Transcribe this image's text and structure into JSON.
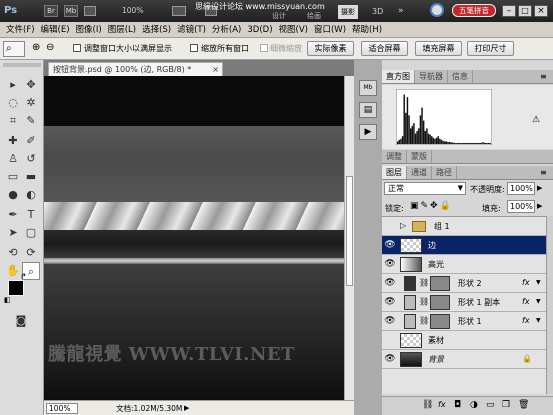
{
  "titlebar": {
    "app_logo": "Ps",
    "mini_buttons": [
      "Br",
      "Mb"
    ],
    "zoom": "100%",
    "workspace_buttons": [
      "设计",
      "绘画",
      "摄影",
      "3D"
    ],
    "more": "»",
    "watermark": "思缘设计论坛 www.missyuan.com",
    "ime_badge": "五笔拼音"
  },
  "menubar": {
    "items": [
      "文件(F)",
      "编辑(E)",
      "图像(I)",
      "图层(L)",
      "选择(S)",
      "滤镜(T)",
      "分析(A)",
      "3D(D)",
      "视图(V)",
      "窗口(W)",
      "帮助(H)"
    ]
  },
  "options": {
    "resize_windows": "调整窗口大小以满屏显示",
    "zoom_all": "缩放所有窗口",
    "scrubby_zoom": "细微缩放",
    "actual_pixels": "实际像素",
    "fit_screen": "适合屏幕",
    "fill_screen": "填充屏幕",
    "print_size": "打印尺寸"
  },
  "document": {
    "tab_title": "按钮背景.psd @ 100% (边, RGB/8) *",
    "close": "×",
    "watermark": "騰龍視覺 WWW.TLVI.NET",
    "zoom": "100%",
    "doc_size": "文档:1.02M/5.30M"
  },
  "histogram": {
    "tabs": [
      "直方图",
      "导航器",
      "信息"
    ],
    "bars": [
      0.05,
      0.08,
      0.1,
      0.15,
      0.95,
      0.6,
      0.9,
      0.55,
      0.3,
      0.35,
      0.4,
      0.2,
      0.25,
      0.3,
      0.55,
      0.7,
      0.45,
      0.25,
      0.3,
      0.2,
      0.18,
      0.15,
      0.12,
      0.1,
      0.12,
      0.15,
      0.1,
      0.08,
      0.06,
      0.05,
      0.05,
      0.04,
      0.04,
      0.03,
      0.03,
      0.02,
      0.02,
      0.02,
      0.02,
      0.02,
      0.02,
      0.02,
      0.02,
      0.02,
      0.02,
      0.02,
      0.02,
      0.02,
      0.02,
      0.02,
      0.02,
      0.02,
      0.03,
      0.03,
      0.02,
      0.02,
      0.02,
      0.02
    ]
  },
  "adjust_tabs": [
    "调整",
    "蒙版"
  ],
  "layers_panel": {
    "tabs": [
      "图层",
      "通道",
      "路径"
    ],
    "blend_mode": "正常",
    "opacity_label": "不透明度:",
    "opacity": "100%",
    "lock_label": "锁定:",
    "fill_label": "填充:",
    "fill": "100%",
    "group_name": "组 1",
    "layers": [
      {
        "name": "边",
        "selected": true,
        "visible": true,
        "fx": false
      },
      {
        "name": "高光",
        "selected": false,
        "visible": true,
        "fx": false
      },
      {
        "name": "形状 2",
        "selected": false,
        "visible": true,
        "fx": true
      },
      {
        "name": "形状 1 副本",
        "selected": false,
        "visible": true,
        "fx": true
      },
      {
        "name": "形状 1",
        "selected": false,
        "visible": true,
        "fx": true
      },
      {
        "name": "素材",
        "selected": false,
        "visible": false,
        "fx": false
      },
      {
        "name": "背景",
        "selected": false,
        "visible": true,
        "fx": false
      }
    ],
    "fx_symbol": "fx"
  },
  "colors": {
    "selection": "#0a246a",
    "titlebar": "#2a2a2a",
    "ime_red": "#c0282d"
  }
}
